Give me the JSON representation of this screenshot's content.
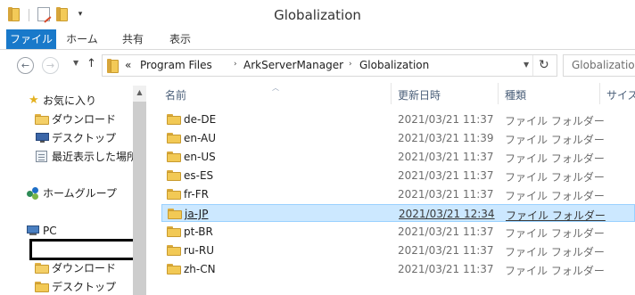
{
  "window": {
    "title": "Globalization"
  },
  "quick_access": {
    "dropdown_glyph": "▾"
  },
  "ribbon": {
    "tabs": [
      {
        "label": "ファイル",
        "active": true
      },
      {
        "label": "ホーム"
      },
      {
        "label": "共有"
      },
      {
        "label": "表示"
      }
    ]
  },
  "address": {
    "back_glyph": "←",
    "forward_glyph": "→",
    "up_glyph": "↑",
    "prefix": "«",
    "crumbs": [
      "Program Files",
      "ArkServerManager",
      "Globalization"
    ],
    "refresh_glyph": "↻",
    "search_placeholder": "Globalization"
  },
  "nav": {
    "favorites": "お気に入り",
    "downloads": "ダウンロード",
    "desktop": "デスクトップ",
    "recent": "最近表示した場所",
    "homegroup": "ホームグループ",
    "pc": "PC",
    "pc_downloads": "ダウンロード",
    "pc_desktop": "デスクトップ"
  },
  "columns": {
    "name": "名前",
    "date": "更新日時",
    "type": "種類",
    "size": "サイズ"
  },
  "files": [
    {
      "name": "de-DE",
      "date": "2021/03/21 11:37",
      "type": "ファイル フォルダー"
    },
    {
      "name": "en-AU",
      "date": "2021/03/21 11:39",
      "type": "ファイル フォルダー"
    },
    {
      "name": "en-US",
      "date": "2021/03/21 11:37",
      "type": "ファイル フォルダー"
    },
    {
      "name": "es-ES",
      "date": "2021/03/21 11:37",
      "type": "ファイル フォルダー"
    },
    {
      "name": "fr-FR",
      "date": "2021/03/21 11:37",
      "type": "ファイル フォルダー"
    },
    {
      "name": "ja-JP",
      "date": "2021/03/21 12:34",
      "type": "ファイル フォルダー",
      "selected": true
    },
    {
      "name": "pt-BR",
      "date": "2021/03/21 11:37",
      "type": "ファイル フォルダー"
    },
    {
      "name": "ru-RU",
      "date": "2021/03/21 11:37",
      "type": "ファイル フォルダー"
    },
    {
      "name": "zh-CN",
      "date": "2021/03/21 11:37",
      "type": "ファイル フォルダー"
    }
  ],
  "colors": {
    "file_tab": "#1979ca",
    "selection": "#cce8ff",
    "selection_border": "#99d1ff",
    "column_header": "#4c607a"
  }
}
